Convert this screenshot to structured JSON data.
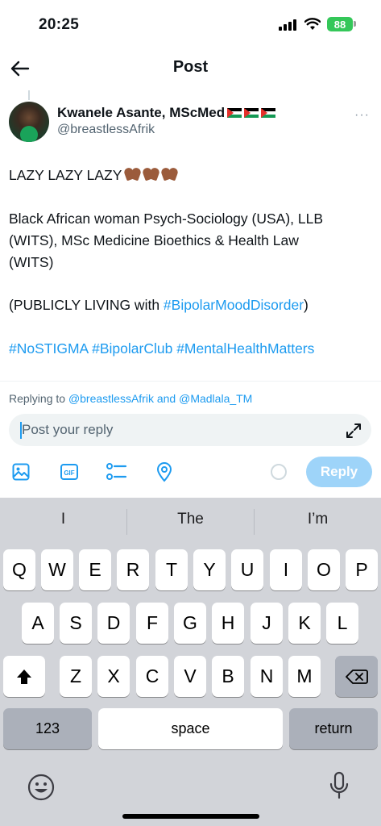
{
  "status_bar": {
    "time": "20:25",
    "battery": "88"
  },
  "header": {
    "title": "Post"
  },
  "author": {
    "name": "Kwanele Asante, MScMed",
    "handle": "@breastlessAfrik",
    "more": "···"
  },
  "post": {
    "line1": "LAZY LAZY LAZY",
    "line2": "Black African woman Psych-Sociology (USA), LLB",
    "line3": "(WITS), MSc Medicine Bioethics & Health Law",
    "line4": "(WITS)",
    "line5_prefix": "(PUBLICLY LIVING with ",
    "line5_hashtag": "#BipolarMoodDisorder",
    "line5_suffix": ")",
    "hashtags": [
      "#NoSTIGMA",
      "#BipolarClub",
      "#MentalHealthMatters"
    ]
  },
  "reply": {
    "replying_prefix": "Replying to ",
    "mention1": "@breastlessAfrik",
    "and": " and ",
    "mention2": "@Madlala_TM",
    "placeholder": "Post your reply",
    "button_label": "Reply"
  },
  "keyboard": {
    "suggestions": [
      "I",
      "The",
      "I’m"
    ],
    "row1": [
      "Q",
      "W",
      "E",
      "R",
      "T",
      "Y",
      "U",
      "I",
      "O",
      "P"
    ],
    "row2": [
      "A",
      "S",
      "D",
      "F",
      "G",
      "H",
      "J",
      "K",
      "L"
    ],
    "row3": [
      "Z",
      "X",
      "C",
      "V",
      "B",
      "N",
      "M"
    ],
    "numbers_key": "123",
    "space_key": "space",
    "return_key": "return"
  }
}
